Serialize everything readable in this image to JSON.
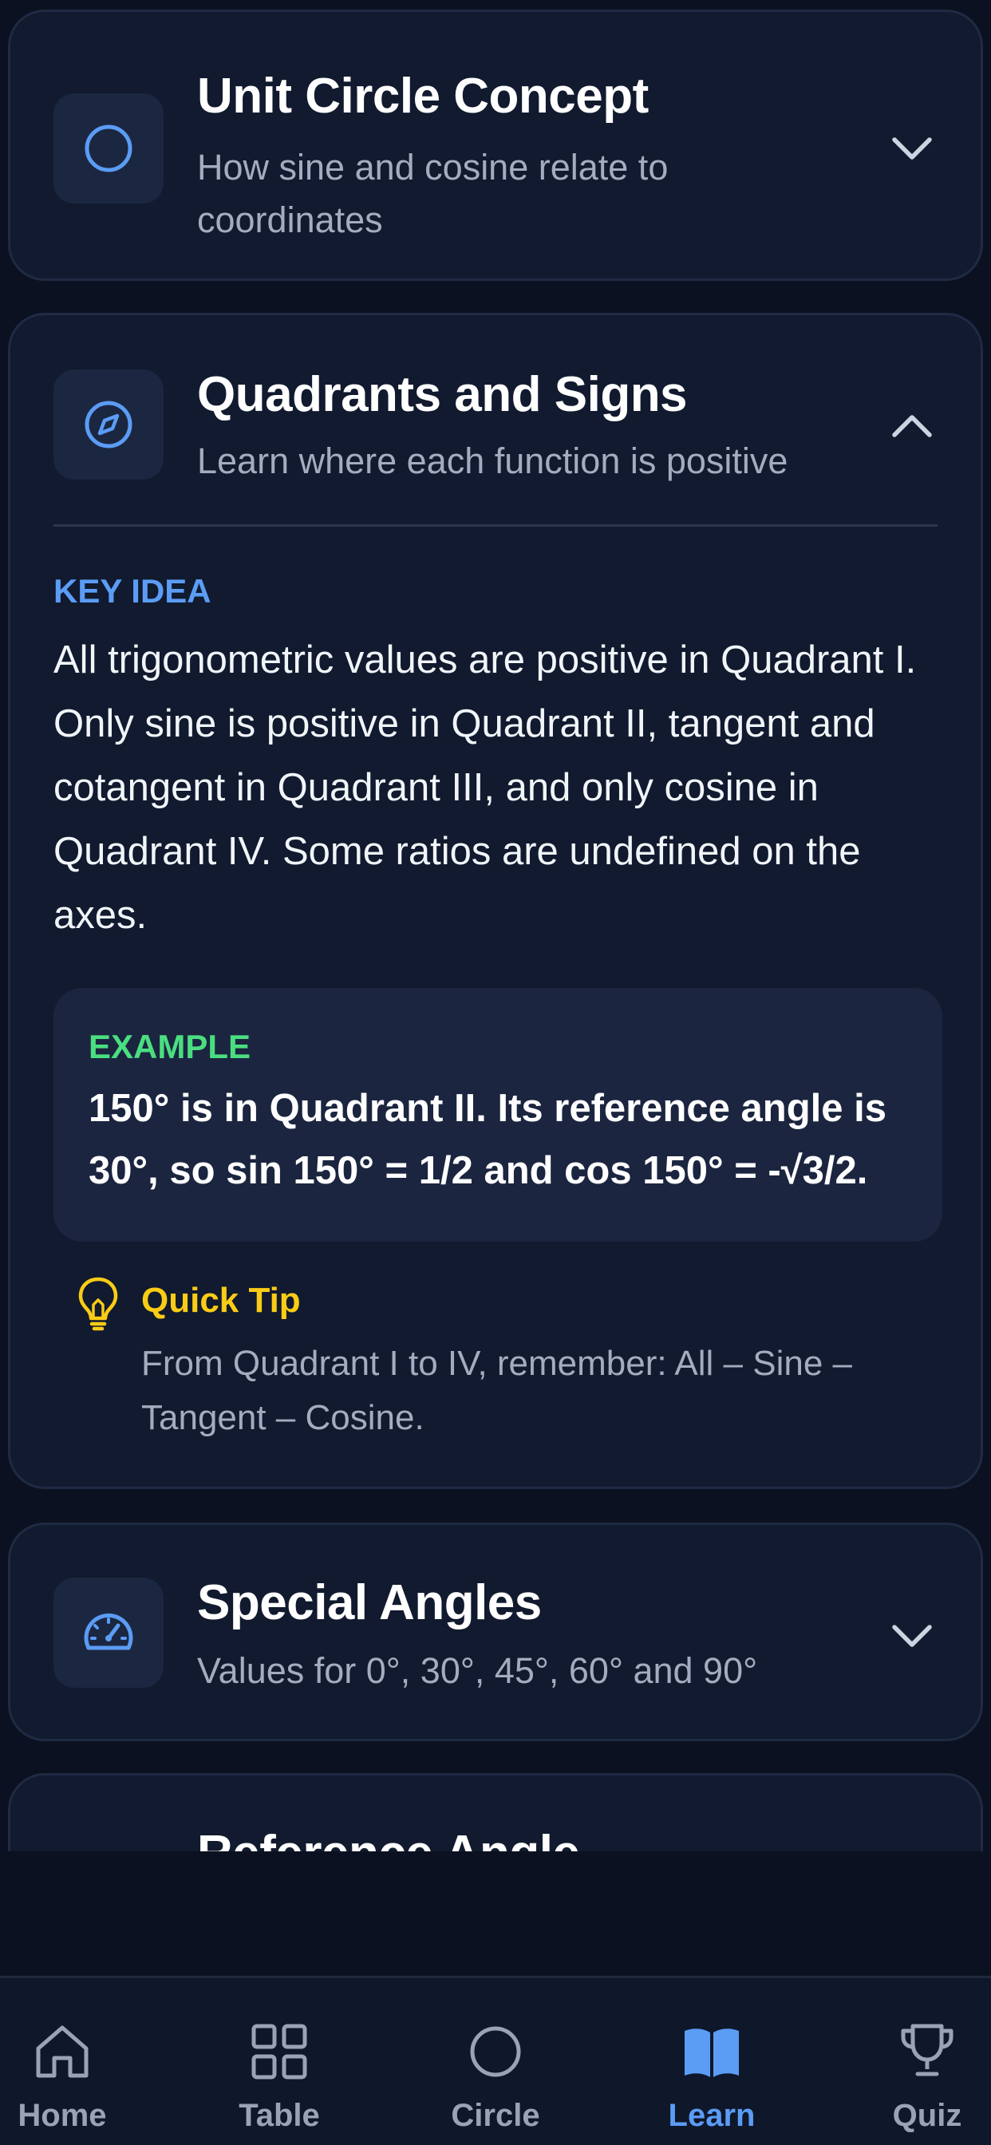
{
  "cards": [
    {
      "title": "Unit Circle Concept",
      "subtitle": "How sine and cosine relate to coordinates",
      "icon": "circle-icon",
      "expanded": false
    },
    {
      "title": "Quadrants and Signs",
      "subtitle": "Learn where each function is positive",
      "icon": "compass-icon",
      "expanded": true,
      "key_idea_label": "KEY IDEA",
      "key_idea_text": "All trigonometric values are positive in Quadrant I. Only sine is positive in Quadrant II, tangent and cotangent in Quadrant III, and only cosine in Quadrant IV. Some ratios are undefined on the axes.",
      "example_label": "EXAMPLE",
      "example_text": "150° is in Quadrant II. Its reference angle is 30°, so sin 150° = 1/2 and cos 150° = -√3/2.",
      "tip_title": "Quick Tip",
      "tip_text": "From Quadrant I to IV, remember: All – Sine – Tangent – Cosine."
    },
    {
      "title": "Special Angles",
      "subtitle": "Values for 0°, 30°, 45°, 60° and 90°",
      "icon": "gauge-icon",
      "expanded": false
    },
    {
      "title": "Reference Angle",
      "icon": "unknown-icon",
      "expanded": false
    }
  ],
  "nav": {
    "items": [
      {
        "label": "Home",
        "icon": "home-icon"
      },
      {
        "label": "Table",
        "icon": "grid-icon"
      },
      {
        "label": "Circle",
        "icon": "circle-icon"
      },
      {
        "label": "Learn",
        "icon": "book-icon"
      },
      {
        "label": "Quiz",
        "icon": "trophy-icon"
      }
    ],
    "active": "Learn"
  },
  "colors": {
    "background": "#0b1120",
    "card": "#111a2e",
    "accent": "#5b9cf5",
    "example_green": "#4ade80",
    "tip_yellow": "#facc15"
  }
}
